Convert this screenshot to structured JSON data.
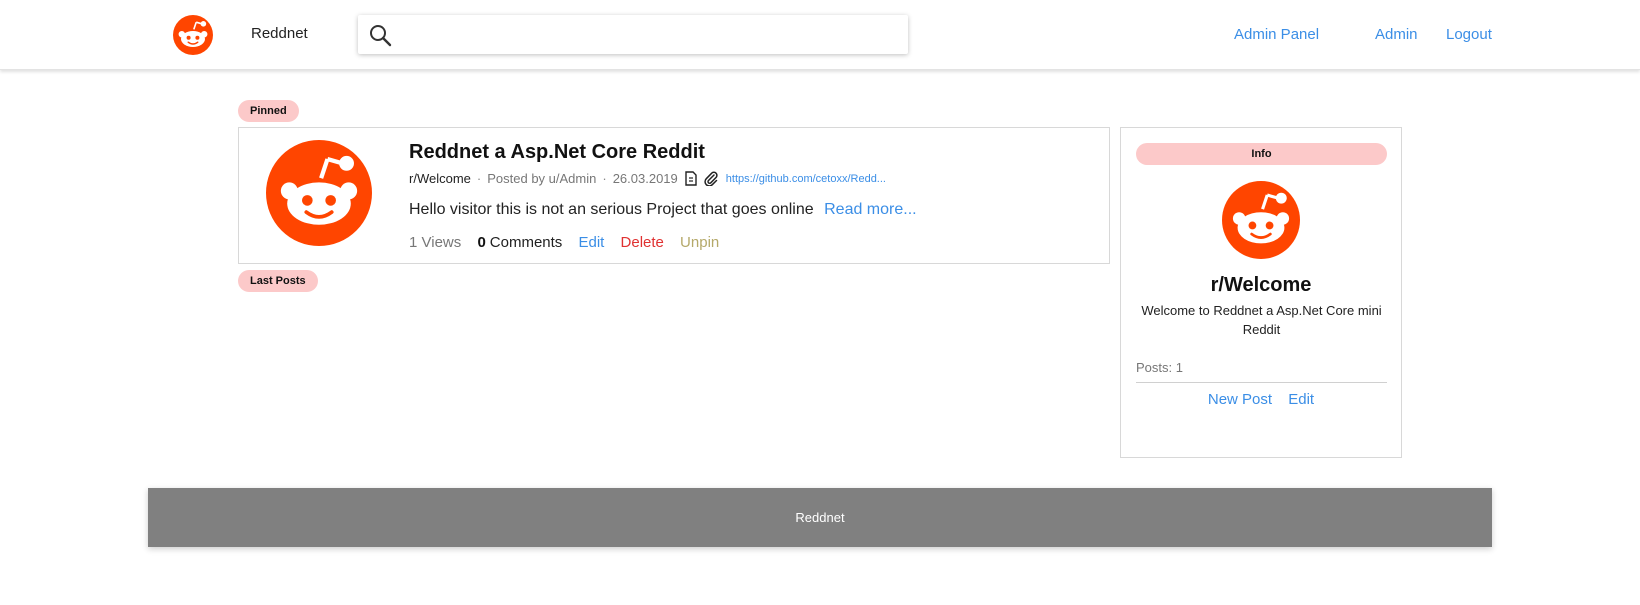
{
  "nav": {
    "brand": "Reddnet",
    "search_placeholder": "",
    "search_value": "",
    "links": {
      "admin_panel": "Admin Panel",
      "admin": "Admin",
      "logout": "Logout"
    }
  },
  "tags": {
    "pinned": "Pinned",
    "last_posts": "Last Posts"
  },
  "post": {
    "title": "Reddnet a Asp.Net Core Reddit",
    "subreddit": "r/Welcome",
    "posted_by": "Posted by u/Admin",
    "date": "26.03.2019",
    "url": "https://github.com/cetoxx/Redd...",
    "body": "Hello visitor this is not an serious Project that goes online",
    "read_more": "Read more...",
    "views": "1 Views",
    "comments_count": "0",
    "comments_label": "Comments",
    "edit": "Edit",
    "delete": "Delete",
    "unpin": "Unpin"
  },
  "info": {
    "badge": "Info",
    "title": "r/Welcome",
    "description": "Welcome to Reddnet a Asp.Net Core mini Reddit",
    "posts": "Posts: 1",
    "new_post": "New Post",
    "edit": "Edit"
  },
  "footer": {
    "text": "Reddnet"
  },
  "colors": {
    "brand_orange": "#ff4500",
    "link_blue": "#3b8ee6",
    "delete_red": "#e03131",
    "unpin_olive": "#b5a96a",
    "tag_pink": "#fcc9c9",
    "footer_gray": "#808080"
  },
  "icons": {
    "logo": "reddit-alien-icon",
    "search": "search-icon",
    "text_post": "document-icon",
    "link_post": "paperclip-icon"
  }
}
